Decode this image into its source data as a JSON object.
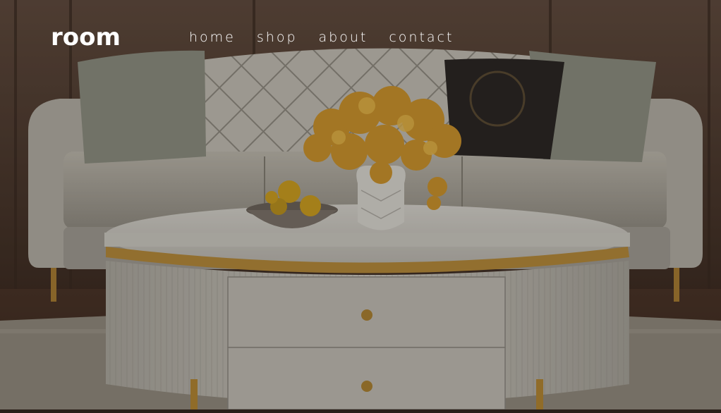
{
  "brand": {
    "logo_text": "room"
  },
  "nav": {
    "items": [
      {
        "label": "home"
      },
      {
        "label": "shop"
      },
      {
        "label": "about"
      },
      {
        "label": "contact"
      }
    ]
  },
  "hero": {
    "image": "living-room-photo",
    "colors": {
      "wall": "#5a4436",
      "sofa": "#b9b4aa",
      "table": "#d9d5cc",
      "flowers": "#e2a531",
      "gold": "#b8862f"
    }
  }
}
